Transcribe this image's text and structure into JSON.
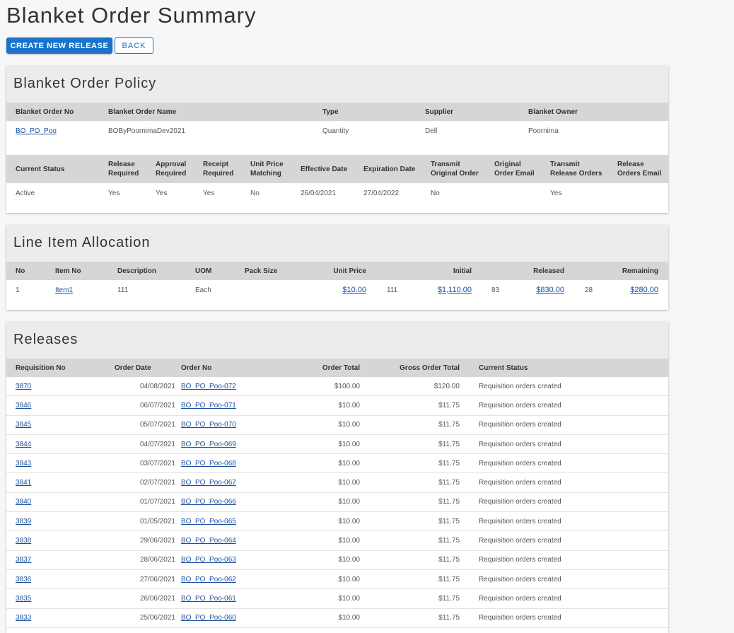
{
  "page": {
    "title": "Blanket Order Summary",
    "create_release_label": "CREATE NEW RELEASE",
    "back_label": "BACK"
  },
  "policy": {
    "heading": "Blanket Order Policy",
    "headers1": [
      "Blanket Order No",
      "Blanket Order Name",
      "Type",
      "Supplier",
      "Blanket Owner"
    ],
    "row1": {
      "order_no": "BO_PO_Poo",
      "order_name": "BOByPoornimaDev2021",
      "type": "Quantity",
      "supplier": "Dell",
      "owner": "Poornima"
    },
    "headers2": {
      "current_status": "Current Status",
      "release_required": [
        "Release",
        "Required"
      ],
      "approval_required": [
        "Approval",
        "Required"
      ],
      "receipt_required": [
        "Receipt",
        "Required"
      ],
      "unit_price_matching": [
        "Unit Price",
        "Matching"
      ],
      "effective_date": "Effective Date",
      "expiration_date": "Expiration Date",
      "transmit_original": [
        "Transmit",
        "Original Order"
      ],
      "original_email": [
        "Original",
        "Order Email"
      ],
      "transmit_release": [
        "Transmit",
        "Release Orders"
      ],
      "release_email": [
        "Release",
        "Orders Email"
      ]
    },
    "row2": {
      "current_status": "Active",
      "release_required": "Yes",
      "approval_required": "Yes",
      "receipt_required": "Yes",
      "unit_price_matching": "No",
      "effective_date": "26/04/2021",
      "expiration_date": "27/04/2022",
      "transmit_original": "No",
      "original_email": "",
      "transmit_release": "Yes",
      "release_email": ""
    }
  },
  "allocation": {
    "heading": "Line Item Allocation",
    "headers": {
      "no": "No",
      "item_no": "Item No",
      "description": "Description",
      "uom": "UOM",
      "pack_size": "Pack Size",
      "unit_price": "Unit Price",
      "initial": "Initial",
      "released": "Released",
      "remaining": "Remaining"
    },
    "row": {
      "no": "1",
      "item_no": "Item1",
      "description": "111",
      "uom": "Each",
      "pack_size": "",
      "unit_price": "$10.00",
      "initial_qty": "111",
      "initial_amount": "$1,110.00",
      "released_qty": "83",
      "released_amount": "$830.00",
      "remaining_qty": "28",
      "remaining_amount": "$280.00"
    }
  },
  "releases": {
    "heading": "Releases",
    "headers": [
      "Requisition No",
      "Order Date",
      "Order No",
      "Order Total",
      "Gross Order Total",
      "Current Status"
    ],
    "rows": [
      {
        "req": "3870",
        "date": "04/08/2021",
        "order": "BO_PO_Poo-072",
        "total": "$100.00",
        "gross": "$120.00",
        "status": "Requisition orders created"
      },
      {
        "req": "3846",
        "date": "06/07/2021",
        "order": "BO_PO_Poo-071",
        "total": "$10.00",
        "gross": "$11.75",
        "status": "Requisition orders created"
      },
      {
        "req": "3845",
        "date": "05/07/2021",
        "order": "BO_PO_Poo-070",
        "total": "$10.00",
        "gross": "$11.75",
        "status": "Requisition orders created"
      },
      {
        "req": "3844",
        "date": "04/07/2021",
        "order": "BO_PO_Poo-069",
        "total": "$10.00",
        "gross": "$11.75",
        "status": "Requisition orders created"
      },
      {
        "req": "3843",
        "date": "03/07/2021",
        "order": "BO_PO_Poo-068",
        "total": "$10.00",
        "gross": "$11.75",
        "status": "Requisition orders created"
      },
      {
        "req": "3841",
        "date": "02/07/2021",
        "order": "BO_PO_Poo-067",
        "total": "$10.00",
        "gross": "$11.75",
        "status": "Requisition orders created"
      },
      {
        "req": "3840",
        "date": "01/07/2021",
        "order": "BO_PO_Poo-066",
        "total": "$10.00",
        "gross": "$11.75",
        "status": "Requisition orders created"
      },
      {
        "req": "3839",
        "date": "01/05/2021",
        "order": "BO_PO_Poo-065",
        "total": "$10.00",
        "gross": "$11.75",
        "status": "Requisition orders created"
      },
      {
        "req": "3838",
        "date": "29/06/2021",
        "order": "BO_PO_Poo-064",
        "total": "$10.00",
        "gross": "$11.75",
        "status": "Requisition orders created"
      },
      {
        "req": "3837",
        "date": "28/06/2021",
        "order": "BO_PO_Poo-063",
        "total": "$10.00",
        "gross": "$11.75",
        "status": "Requisition orders created"
      },
      {
        "req": "3836",
        "date": "27/06/2021",
        "order": "BO_PO_Poo-062",
        "total": "$10.00",
        "gross": "$11.75",
        "status": "Requisition orders created"
      },
      {
        "req": "3835",
        "date": "26/06/2021",
        "order": "BO_PO_Poo-061",
        "total": "$10.00",
        "gross": "$11.75",
        "status": "Requisition orders created"
      },
      {
        "req": "3833",
        "date": "25/06/2021",
        "order": "BO_PO_Poo-060",
        "total": "$10.00",
        "gross": "$11.75",
        "status": "Requisition orders created"
      }
    ]
  },
  "colors": {
    "accent": "#1a73c8",
    "link": "#1a4fa0",
    "table_header_bg": "#d6d6d6",
    "card_header_bg": "#ececec",
    "page_bg": "#f7f7f7"
  }
}
